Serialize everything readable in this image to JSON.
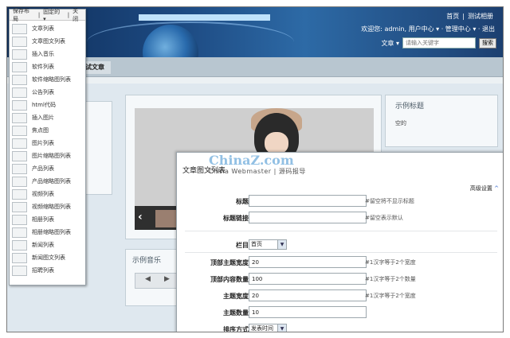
{
  "header": {
    "top_links": [
      "首页",
      "|",
      "测试相册"
    ],
    "user_line": "欢迎您: admin, 用户中心 ▾ · 管理中心 ▾ · 退出",
    "search_label": "文章 ▾",
    "search_placeholder": "请输入关键字",
    "search_button": "搜索"
  },
  "nav": {
    "tab_label": "试文章"
  },
  "panels": {
    "right_title": "示例标题",
    "right_content": "空的",
    "music_title": "示例音乐"
  },
  "menu": {
    "head": [
      "保存布局",
      "|",
      "固定的 ▾",
      "|",
      "关闭"
    ],
    "items": [
      "文章列表",
      "文章图文列表",
      "插入音乐",
      "软件列表",
      "软件缩略图列表",
      "公告列表",
      "html代码",
      "插入图片",
      "焦点图",
      "图片列表",
      "图片缩略图列表",
      "产品列表",
      "产品缩略图列表",
      "视频列表",
      "视频缩略图列表",
      "相册列表",
      "相册缩略图列表",
      "新闻列表",
      "新闻图文列表",
      "招聘列表"
    ]
  },
  "form": {
    "title": "文章图文列表",
    "watermark": "ChinaZ.com",
    "watermark_sub": "China Webmaster | 源码报导",
    "advanced": "高级设置",
    "fields": {
      "title_label": "标题",
      "title_note": "#留空将不显示标题",
      "link_label": "标题链接",
      "link_note": "#留空表示默认",
      "column_label": "栏目",
      "column_value": "首页",
      "top_width_label": "顶部主题宽度",
      "top_width_value": "20",
      "top_width_note": "#1汉字等于2个宽度",
      "top_count_label": "顶部内容数量",
      "top_count_value": "100",
      "top_count_note": "#1汉字等于2个数量",
      "main_width_label": "主题宽度",
      "main_width_value": "20",
      "main_width_note": "#1汉字等于2个宽度",
      "main_count_label": "主题数量",
      "main_count_value": "10",
      "sort_label": "排序方式",
      "sort_value": "发表时间"
    }
  }
}
